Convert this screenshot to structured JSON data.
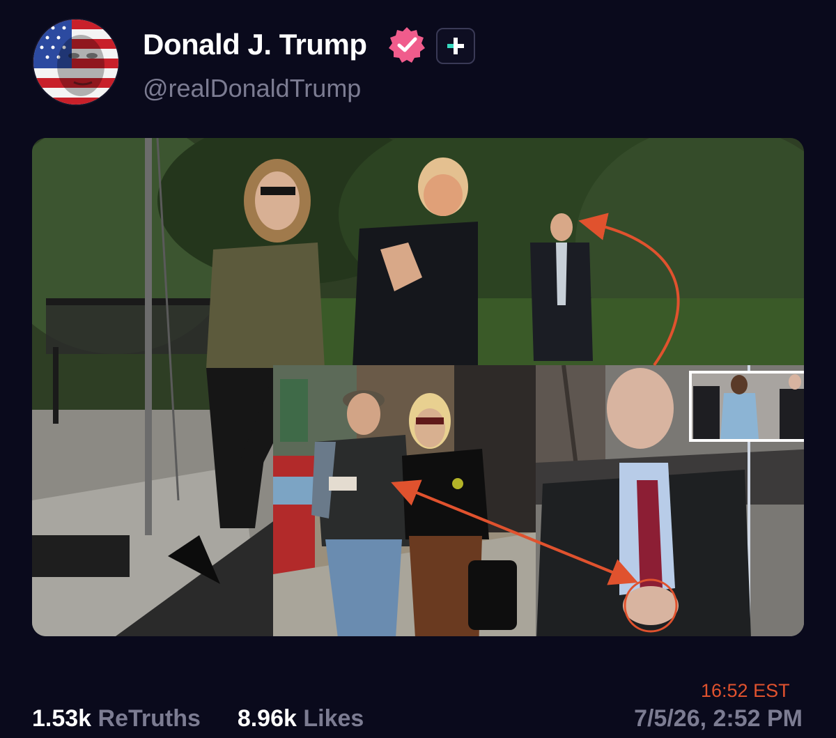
{
  "post": {
    "display_name": "Donald J. Trump",
    "handle": "@realDonaldTrump",
    "verified_icon": "verified-badge-icon",
    "plus_icon": "plus-badge-icon",
    "media": {
      "overlay_time": "16:52 EST",
      "annotation_color": "#e0522e"
    },
    "stats": {
      "retruths_count": "1.53k",
      "retruths_label": "ReTruths",
      "likes_count": "8.96k",
      "likes_label": "Likes"
    },
    "timestamp": "7/5/26, 2:52 PM"
  },
  "colors": {
    "background": "#0a0a1c",
    "verified": "#f05c8c",
    "plus_accent": "#38d9c0",
    "muted_text": "#7c7c92"
  }
}
